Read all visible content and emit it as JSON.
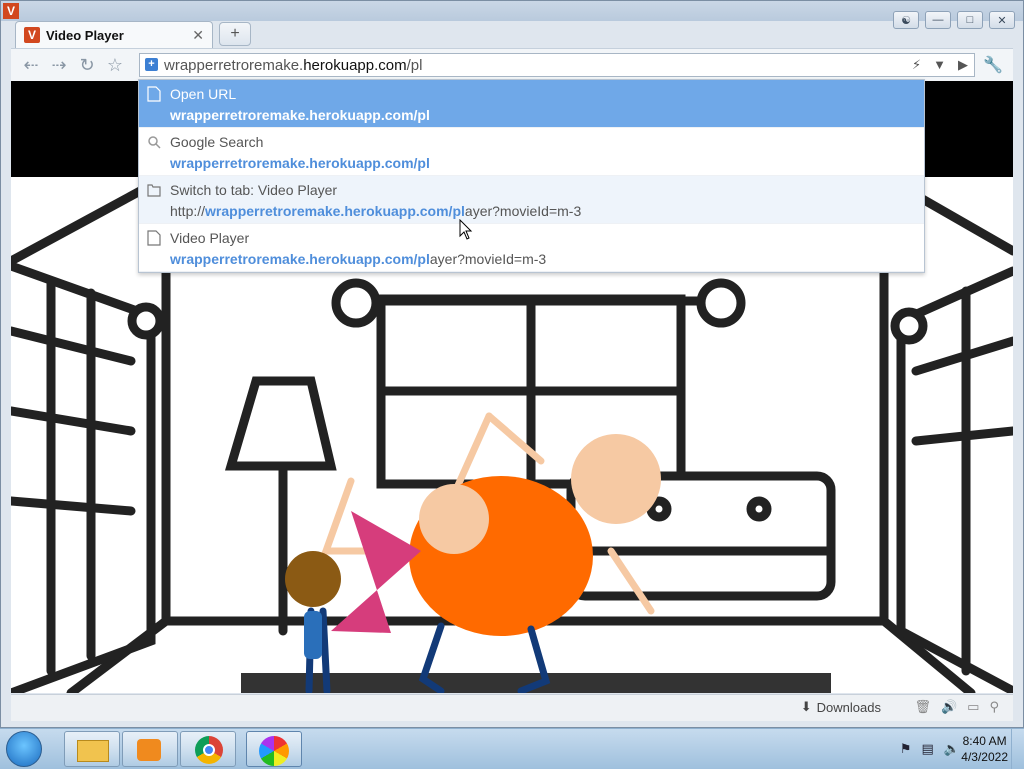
{
  "tab": {
    "title": "Video Player",
    "favicon": "V"
  },
  "omnibox": {
    "url_prefix": "wrapperretroremake.",
    "url_host": "herokuapp.com",
    "url_suffix": "/pl"
  },
  "suggestions": [
    {
      "line1": "Open URL",
      "line2_bold": "wrapperretroremake.herokuapp.com/pl",
      "line2_rest": "",
      "icon": "page-icon",
      "state": "selected"
    },
    {
      "line1": "Google Search",
      "line2_bold": "wrapperretroremake.herokuapp.com/pl",
      "line2_rest": "",
      "icon": "search-icon",
      "state": "normal"
    },
    {
      "line1": "Switch to tab: Video Player",
      "line2_prefix": "http://",
      "line2_bold": "wrapperretroremake.herokuapp.com/pl",
      "line2_rest": "ayer?movieId=m-3",
      "icon": "tab-icon",
      "state": "hover"
    },
    {
      "line1": "Video Player",
      "line2_bold": "wrapperretroremake.herokuapp.com/pl",
      "line2_rest": "ayer?movieId=m-3",
      "icon": "page-icon",
      "state": "normal"
    }
  ],
  "statusbar": {
    "downloads_label": "Downloads"
  },
  "clock": {
    "time": "8:40 AM",
    "date": "4/3/2022"
  },
  "colors": {
    "selected_row": "#6fa8e8",
    "match_text": "#4f8edb",
    "orange_character": "#ff6a00",
    "pink_character": "#d63d7c"
  }
}
